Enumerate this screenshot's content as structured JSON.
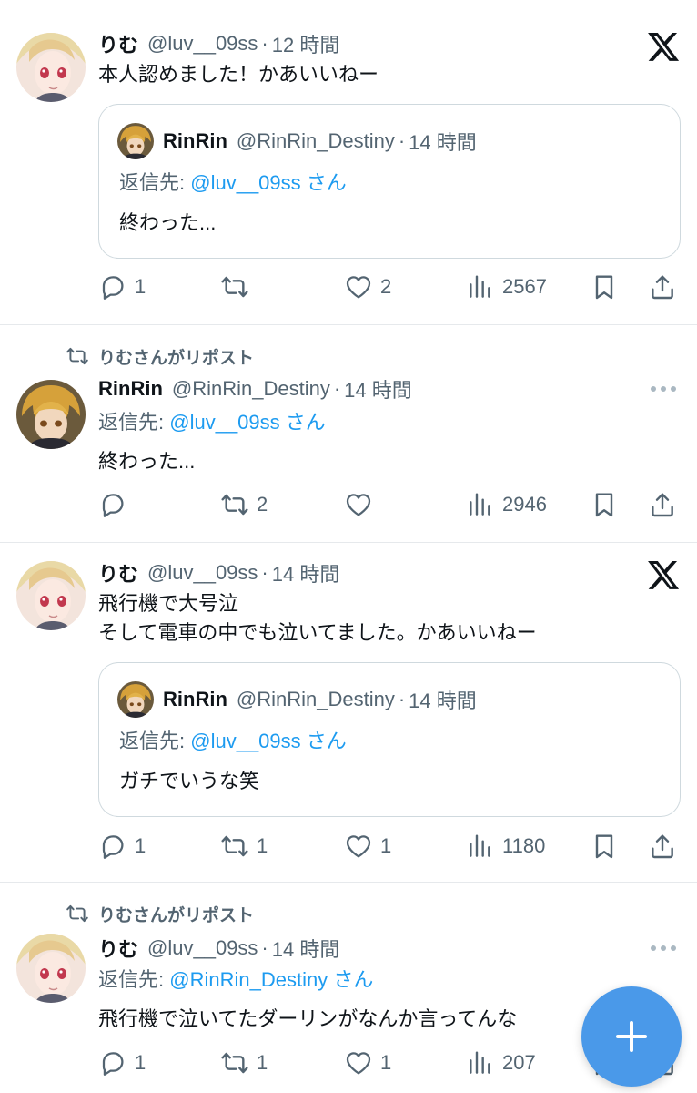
{
  "tweets": [
    {
      "name": "りむ",
      "handle": "@luv__09ss",
      "separator": "·",
      "time": "12 時間",
      "lines": [
        "本人認めました！かあいいねー"
      ],
      "quote": {
        "name": "RinRin",
        "handle": "@RinRin_Destiny",
        "time": "14 時間",
        "reply_label": "返信先:",
        "reply_mention": "@luv__09ss",
        "reply_suffix": "さん",
        "text": "終わった..."
      },
      "stats": {
        "replies": "1",
        "reposts": "",
        "likes": "2",
        "views": "2567"
      }
    },
    {
      "repost_banner": "りむさんがリポスト",
      "name": "RinRin",
      "handle": "@RinRin_Destiny",
      "separator": "·",
      "time": "14 時間",
      "reply_label": "返信先:",
      "reply_mention": "@luv__09ss",
      "reply_suffix": "さん",
      "lines": [
        "終わった..."
      ],
      "stats": {
        "replies": "",
        "reposts": "2",
        "likes": "",
        "views": "2946"
      }
    },
    {
      "name": "りむ",
      "handle": "@luv__09ss",
      "separator": "·",
      "time": "14 時間",
      "lines": [
        "飛行機で大号泣",
        "そして電車の中でも泣いてました。かあいいねー"
      ],
      "quote": {
        "name": "RinRin",
        "handle": "@RinRin_Destiny",
        "time": "14 時間",
        "reply_label": "返信先:",
        "reply_mention": "@luv__09ss",
        "reply_suffix": "さん",
        "text": "ガチでいうな笑"
      },
      "stats": {
        "replies": "1",
        "reposts": "1",
        "likes": "1",
        "views": "1180"
      }
    },
    {
      "repost_banner": "りむさんがリポスト",
      "name": "りむ",
      "handle": "@luv__09ss",
      "separator": "·",
      "time": "14 時間",
      "reply_label": "返信先:",
      "reply_mention": "@RinRin_Destiny",
      "reply_suffix": "さん",
      "lines": [
        "飛行機で泣いてたダーリンがなんか言ってんな"
      ],
      "stats": {
        "replies": "1",
        "reposts": "1",
        "likes": "1",
        "views": "207"
      }
    }
  ],
  "icons": {
    "reply": "reply-icon",
    "repost": "repost-icon",
    "like": "heart-icon",
    "views": "views-icon",
    "bookmark": "bookmark-icon",
    "share": "share-icon",
    "x_logo": "x-logo-icon",
    "more": "more-icon",
    "compose": "plus-icon"
  },
  "colors": {
    "accent": "#1d9bf0",
    "muted": "#536471",
    "fab": "#4a99e9",
    "text": "#0f1419"
  }
}
